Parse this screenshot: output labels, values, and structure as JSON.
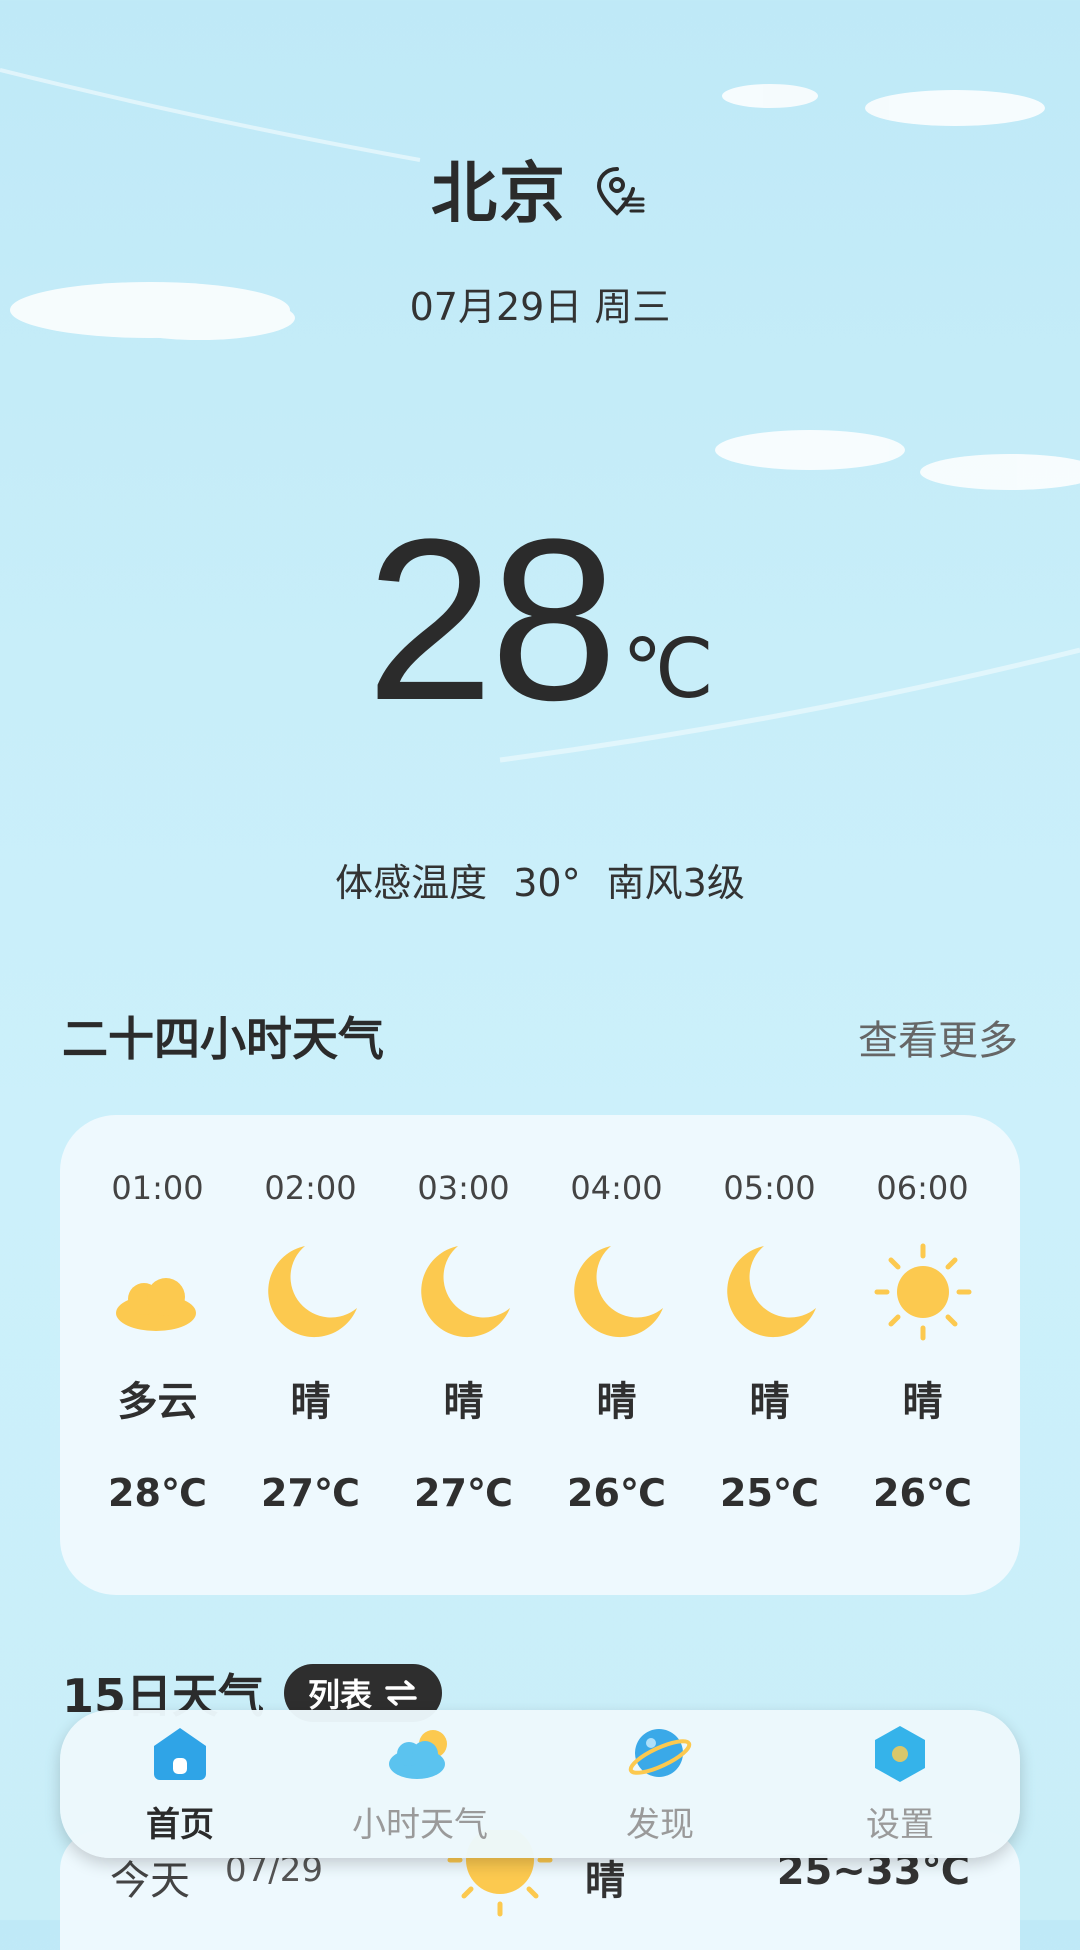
{
  "header": {
    "city": "北京",
    "date": "07月29日 周三"
  },
  "current": {
    "temp": "28",
    "unit": "℃",
    "feels": "体感温度 30°  南风3级"
  },
  "hourly_section": {
    "title": "二十四小时天气",
    "more_label": "查看更多",
    "items": [
      {
        "time": "01:00",
        "icon": "cloudy-night-icon",
        "cond": "多云",
        "temp": "28℃"
      },
      {
        "time": "02:00",
        "icon": "moon-icon",
        "cond": "晴",
        "temp": "27℃"
      },
      {
        "time": "03:00",
        "icon": "moon-icon",
        "cond": "晴",
        "temp": "27℃"
      },
      {
        "time": "04:00",
        "icon": "moon-icon",
        "cond": "晴",
        "temp": "26℃"
      },
      {
        "time": "05:00",
        "icon": "moon-icon",
        "cond": "晴",
        "temp": "25℃"
      },
      {
        "time": "06:00",
        "icon": "sun-icon",
        "cond": "晴",
        "temp": "26℃"
      }
    ]
  },
  "daily_section": {
    "title": "15日天气",
    "toggle_label": "列表",
    "row": {
      "day": "今天",
      "date": "07/29",
      "cond": "晴",
      "range": "25~33℃"
    }
  },
  "nav": {
    "items": [
      {
        "label": "首页",
        "icon": "home-icon",
        "active": true
      },
      {
        "label": "小时天气",
        "icon": "cloud-sun-icon",
        "active": false
      },
      {
        "label": "发现",
        "icon": "planet-icon",
        "active": false
      },
      {
        "label": "设置",
        "icon": "hexagon-settings-icon",
        "active": false
      }
    ]
  },
  "colors": {
    "sky": "#c8eef9",
    "card": "#f1fafe",
    "sun": "#fcc94f",
    "nav_accent": "#35a8e6"
  }
}
